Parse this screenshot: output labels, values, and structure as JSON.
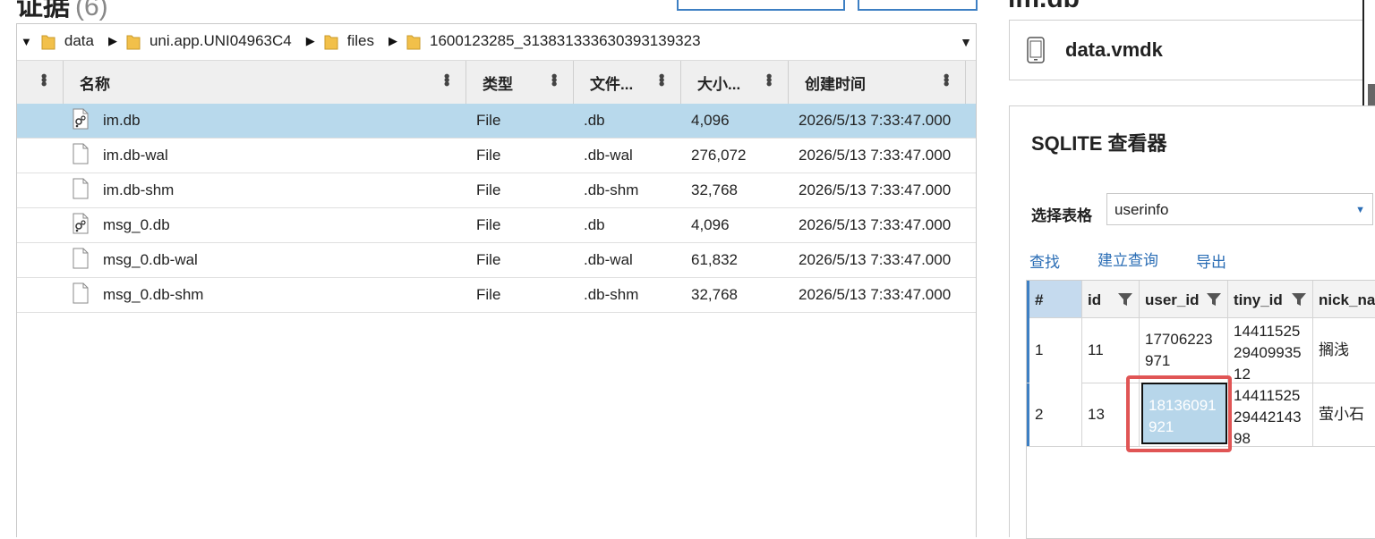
{
  "top": {
    "title": "证据",
    "count": "(6)",
    "right_title": "im.db"
  },
  "breadcrumb": {
    "items": [
      "data",
      "uni.app.UNI04963C4",
      "files",
      "1600123285_313831333630393139323"
    ]
  },
  "file_table": {
    "columns": [
      "名称",
      "类型",
      "文件...",
      "大小...",
      "创建时间"
    ],
    "rows": [
      {
        "name": "im.db",
        "type": "File",
        "ext": ".db",
        "size": "4,096",
        "created": "2026/5/13 7:33:47.000",
        "icon": "db-file-icon",
        "selected": true
      },
      {
        "name": "im.db-wal",
        "type": "File",
        "ext": ".db-wal",
        "size": "276,072",
        "created": "2026/5/13 7:33:47.000",
        "icon": "file-icon",
        "selected": false
      },
      {
        "name": "im.db-shm",
        "type": "File",
        "ext": ".db-shm",
        "size": "32,768",
        "created": "2026/5/13 7:33:47.000",
        "icon": "file-icon",
        "selected": false
      },
      {
        "name": "msg_0.db",
        "type": "File",
        "ext": ".db",
        "size": "4,096",
        "created": "2026/5/13 7:33:47.000",
        "icon": "db-file-icon",
        "selected": false
      },
      {
        "name": "msg_0.db-wal",
        "type": "File",
        "ext": ".db-wal",
        "size": "61,832",
        "created": "2026/5/13 7:33:47.000",
        "icon": "file-icon",
        "selected": false
      },
      {
        "name": "msg_0.db-shm",
        "type": "File",
        "ext": ".db-shm",
        "size": "32,768",
        "created": "2026/5/13 7:33:47.000",
        "icon": "file-icon",
        "selected": false
      }
    ]
  },
  "device": {
    "label": "data.vmdk"
  },
  "sqlite": {
    "title": "SQLITE 查看器",
    "select_label": "选择表格",
    "selected_table": "userinfo",
    "links": [
      "查找",
      "建立查询",
      "导出"
    ],
    "columns": [
      "#",
      "id",
      "user_id",
      "tiny_id",
      "nick_na"
    ],
    "rows": [
      {
        "num": "1",
        "id": "11",
        "user_id_a": "17706223",
        "user_id_b": "971",
        "tiny_id_a": "14411525",
        "tiny_id_b": "29409935",
        "tiny_id_c": "12",
        "nick": "搁浅"
      },
      {
        "num": "2",
        "id": "13",
        "user_id_a": "18136091",
        "user_id_b": "921",
        "tiny_id_a": "14411525",
        "tiny_id_b": "29442143",
        "tiny_id_c": "98",
        "nick": "萤小石"
      }
    ]
  },
  "colors": {
    "selection": "#b8d9ec",
    "accent": "#2a6db5",
    "highlight": "#e05555"
  }
}
